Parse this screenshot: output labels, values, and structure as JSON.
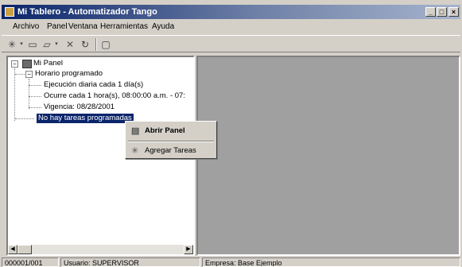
{
  "window": {
    "title": "Mi Tablero - Automatizador Tango",
    "buttons": {
      "minimize": "_",
      "maximize": "□",
      "close": "×"
    }
  },
  "menubar": {
    "items": [
      "Archivo",
      "Panel",
      "Ventana",
      "Herramientas",
      "Ayuda"
    ]
  },
  "toolbar": {
    "icons": [
      "add-task-icon",
      "dropdown-arrow-icon",
      "open-panel-icon",
      "open-folder-icon",
      "dropdown-arrow-icon",
      "delete-icon",
      "refresh-icon",
      "window-icon"
    ]
  },
  "tree": {
    "root": "Mi Panel",
    "schedule": "Horario programado",
    "details": [
      "Ejecución diaria cada 1 día(s)",
      "Ocurre cada 1 hora(s), 08:00:00 a.m. - 07:",
      "Vigencia: 08/28/2001"
    ],
    "no_tasks": "No hay tareas programadas"
  },
  "context_menu": {
    "items": [
      {
        "label": "Abrir Panel",
        "icon": "open-panel-icon",
        "bold": true
      },
      {
        "label": "Agregar Tareas",
        "icon": "add-task-icon",
        "bold": false
      }
    ]
  },
  "statusbar": {
    "id": "000001/001",
    "user": "Usuario: SUPERVISOR",
    "company": "Empresa: Base Ejemplo"
  }
}
